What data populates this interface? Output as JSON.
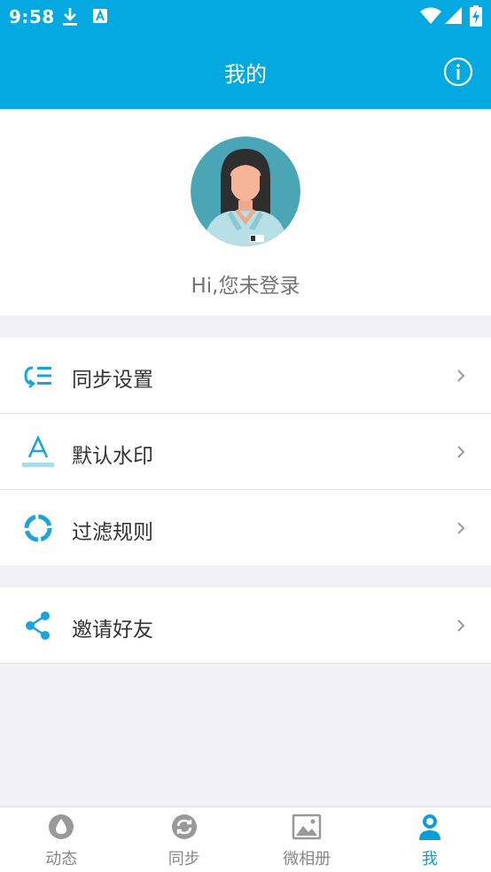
{
  "status_bar": {
    "time": "9:58",
    "icons": [
      "download-icon",
      "a-notification-icon",
      "wifi-icon",
      "signal-icon",
      "battery-charging-icon"
    ]
  },
  "app_bar": {
    "title": "我的",
    "info_icon": "info-icon"
  },
  "profile": {
    "avatar_icon": "female-avatar",
    "greeting": "Hi,您未登录"
  },
  "menu": {
    "group1": [
      {
        "label": "同步设置",
        "icon": "sync-settings-icon"
      },
      {
        "label": "默认水印",
        "icon": "watermark-icon"
      },
      {
        "label": "过滤规则",
        "icon": "filter-rules-icon"
      }
    ],
    "group2": [
      {
        "label": "邀请好友",
        "icon": "share-icon"
      }
    ]
  },
  "bottom_nav": [
    {
      "label": "动态",
      "icon": "drop-icon",
      "active": false
    },
    {
      "label": "同步",
      "icon": "sync-icon",
      "active": false
    },
    {
      "label": "微相册",
      "icon": "image-icon",
      "active": false
    },
    {
      "label": "我",
      "icon": "person-icon",
      "active": true
    }
  ],
  "colors": {
    "primary": "#03a9e0",
    "active_tab": "#0a9fd8",
    "icon_blue": "#1aa3dc",
    "inactive_gray": "#888888",
    "background": "#f2f2f4"
  }
}
